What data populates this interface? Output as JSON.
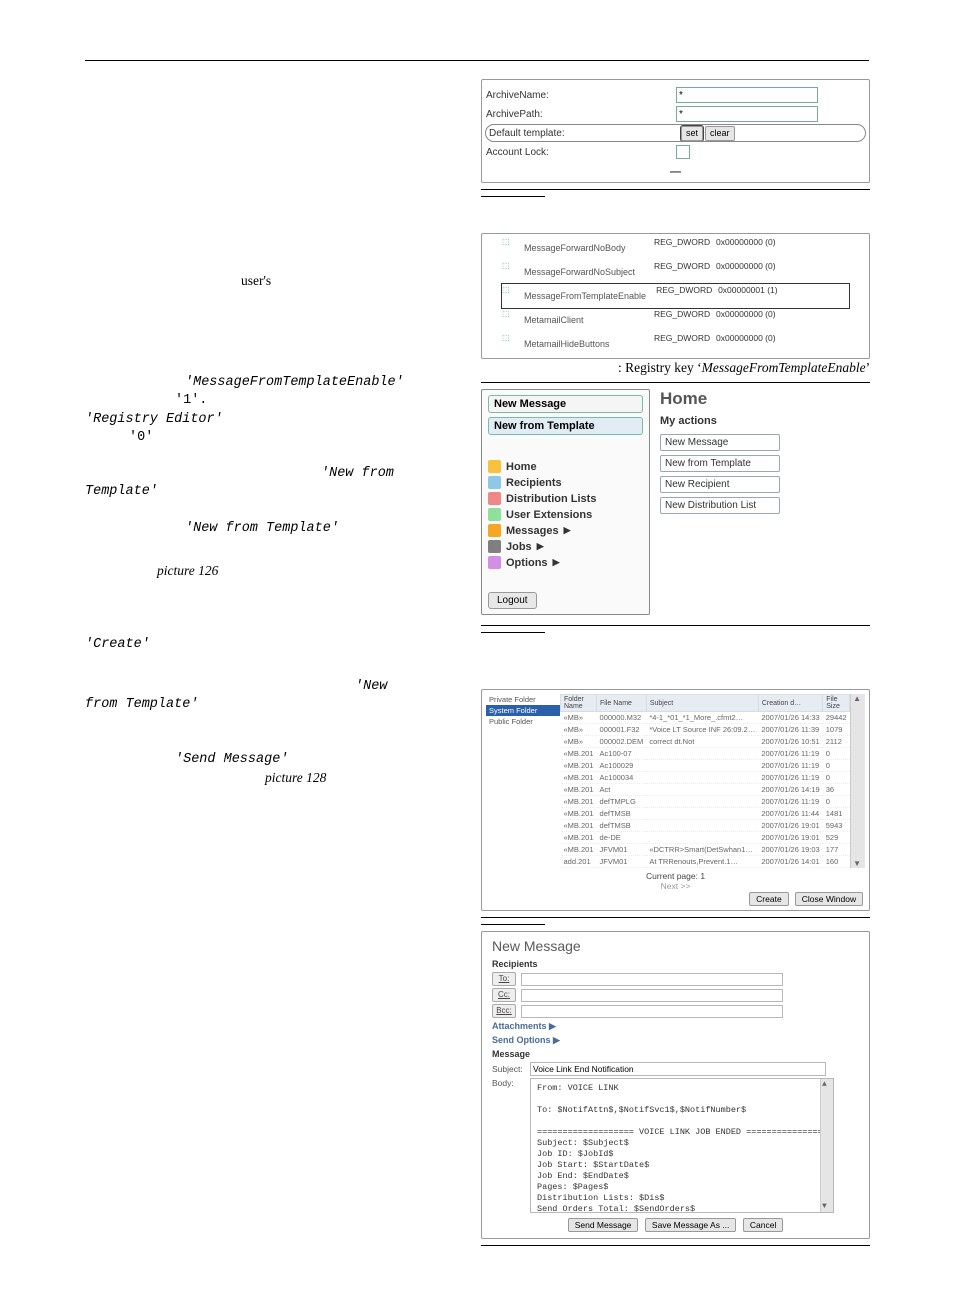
{
  "header_rule_present": true,
  "left_text": {
    "p1_a": "user's",
    "p2_a": "'MessageFromTemplateEnable'",
    "p2_b": "'1'.",
    "p2_c": "'Registry Editor'",
    "p2_d": "'0'",
    "p2_e": "'New from",
    "p2_f": "Template'",
    "p2_g": "'New from Template'",
    "p2_h": "picture 126",
    "p3_a": "'Create'",
    "p3_b": "'New",
    "p3_c": "from Template'",
    "p3_d": "'Send Message'",
    "p3_e": "picture 128"
  },
  "account": {
    "rows": [
      {
        "label": "ArchiveName:",
        "value": "*",
        "kind": "text"
      },
      {
        "label": "ArchivePath:",
        "value": "*",
        "kind": "text"
      },
      {
        "label": "Default template:",
        "value": "",
        "kind": "buttons",
        "btn1": "set",
        "btn2": "clear"
      },
      {
        "label": "Account Lock:",
        "value": "",
        "kind": "check"
      }
    ]
  },
  "registry": {
    "rows": [
      {
        "name": "MessageForwardNoBody",
        "type": "REG_DWORD",
        "value": "0x00000000 (0)",
        "highlight": false
      },
      {
        "name": "MessageForwardNoSubject",
        "type": "REG_DWORD",
        "value": "0x00000000 (0)",
        "highlight": false
      },
      {
        "name": "MessageFromTemplateEnable",
        "type": "REG_DWORD",
        "value": "0x00000001 (1)",
        "highlight": true
      },
      {
        "name": "MetamailClient",
        "type": "REG_DWORD",
        "value": "0x00000000 (0)",
        "highlight": false
      },
      {
        "name": "MetamailHideButtons",
        "type": "REG_DWORD",
        "value": "0x00000000 (0)",
        "highlight": false
      }
    ],
    "caption_prefix": ": Registry key ‘",
    "caption_key": "MessageFromTemplateEnable",
    "caption_suffix": "’"
  },
  "webclient": {
    "new_message": "New Message",
    "new_from_template": "New from Template",
    "nav": [
      {
        "icon": "home-icon",
        "label": "Home"
      },
      {
        "icon": "recipients-icon",
        "label": "Recipients"
      },
      {
        "icon": "distribution-icon",
        "label": "Distribution Lists"
      },
      {
        "icon": "extensions-icon",
        "label": "User Extensions"
      },
      {
        "icon": "messages-icon",
        "label": "Messages",
        "arrow": true
      },
      {
        "icon": "jobs-icon",
        "label": "Jobs",
        "arrow": true
      },
      {
        "icon": "options-icon",
        "label": "Options",
        "arrow": true
      }
    ],
    "logout": "Logout",
    "home_title": "Home",
    "my_actions": "My actions",
    "actions": [
      "New Message",
      "New from Template",
      "New Recipient",
      "New Distribution List"
    ]
  },
  "templates": {
    "folders": [
      "Private Folder",
      "System Folder",
      "Public Folder"
    ],
    "selected_folder_index": 1,
    "columns": [
      "Folder Name",
      "File Name",
      "Subject",
      "Creation d…",
      "File Size"
    ],
    "rows": [
      {
        "c": [
          "«MB»",
          "000000.M32",
          "*4-1_*01_*1_More_.cfmt2…",
          "2007/01/26 14:33",
          "29442"
        ]
      },
      {
        "c": [
          "«MB»",
          "000001.F32",
          "*Voice LT Source INF 26:09.2…",
          "2007/01/26 11:39",
          "1079"
        ]
      },
      {
        "c": [
          "«MB»",
          "000002.DEM",
          "correct dt.Not",
          "2007/01/26 10:51",
          "2112"
        ]
      },
      {
        "c": [
          "«MB.201",
          "Ac100-07",
          "",
          "2007/01/26 11:19",
          "0"
        ]
      },
      {
        "c": [
          "«MB.201",
          "Ac100029",
          "",
          "2007/01/26 11:19",
          "0"
        ]
      },
      {
        "c": [
          "«MB.201",
          "Ac100034",
          "",
          "2007/01/26 11:19",
          "0"
        ]
      },
      {
        "c": [
          "«MB.201",
          "Act",
          "",
          "2007/01/26 14:19",
          "36"
        ]
      },
      {
        "c": [
          "«MB.201",
          "defTMPLG",
          "",
          "2007/01/26 11:19",
          "0"
        ]
      },
      {
        "c": [
          "«MB.201",
          "defTMSB",
          "",
          "2007/01/26 11:44",
          "1481"
        ]
      },
      {
        "c": [
          "«MB.201",
          "defTMSB",
          "",
          "2007/01/26 19:01",
          "5943"
        ]
      },
      {
        "c": [
          "«MB.201",
          "de-DE",
          "",
          "2007/01/26 19:01",
          "529"
        ]
      },
      {
        "c": [
          "«MB.201",
          "JFVM01",
          "«DCTRR>Smart(DetSwhan1…",
          "2007/01/26 19:03",
          "177"
        ]
      },
      {
        "c": [
          "add.201",
          "JFVM01",
          "At TRRenouts,Prevent.1…",
          "2007/01/26 14:01",
          "160"
        ]
      }
    ],
    "current_page": "Current page: 1",
    "next": "Next >>",
    "create": "Create",
    "close": "Close Window"
  },
  "newmsg": {
    "title": "New Message",
    "recipients": "Recipients",
    "to": "To:",
    "cc": "Cc:",
    "bcc": "Bcc:",
    "attachments": "Attachments",
    "send_options": "Send Options",
    "message": "Message",
    "subject_label": "Subject:",
    "subject_value": "Voice Link End Notification",
    "body_label": "Body:",
    "buttons": {
      "send": "Send Message",
      "saveas": "Save Message As ...",
      "cancel": "Cancel"
    },
    "body_text": "From: VOICE LINK\n\nTo: $NotifAttn$,$NotifSvc1$,$NotifNumber$\n\n=================== VOICE LINK JOB ENDED ===================\nSubject: $Subject$\nJob ID: $JobId$\nJob Start: $StartDate$\nJob End: $EndDate$\nPages: $Pages$\nDistribution Lists: $Dis$\nSend Orders Total: $SendOrders$"
  }
}
